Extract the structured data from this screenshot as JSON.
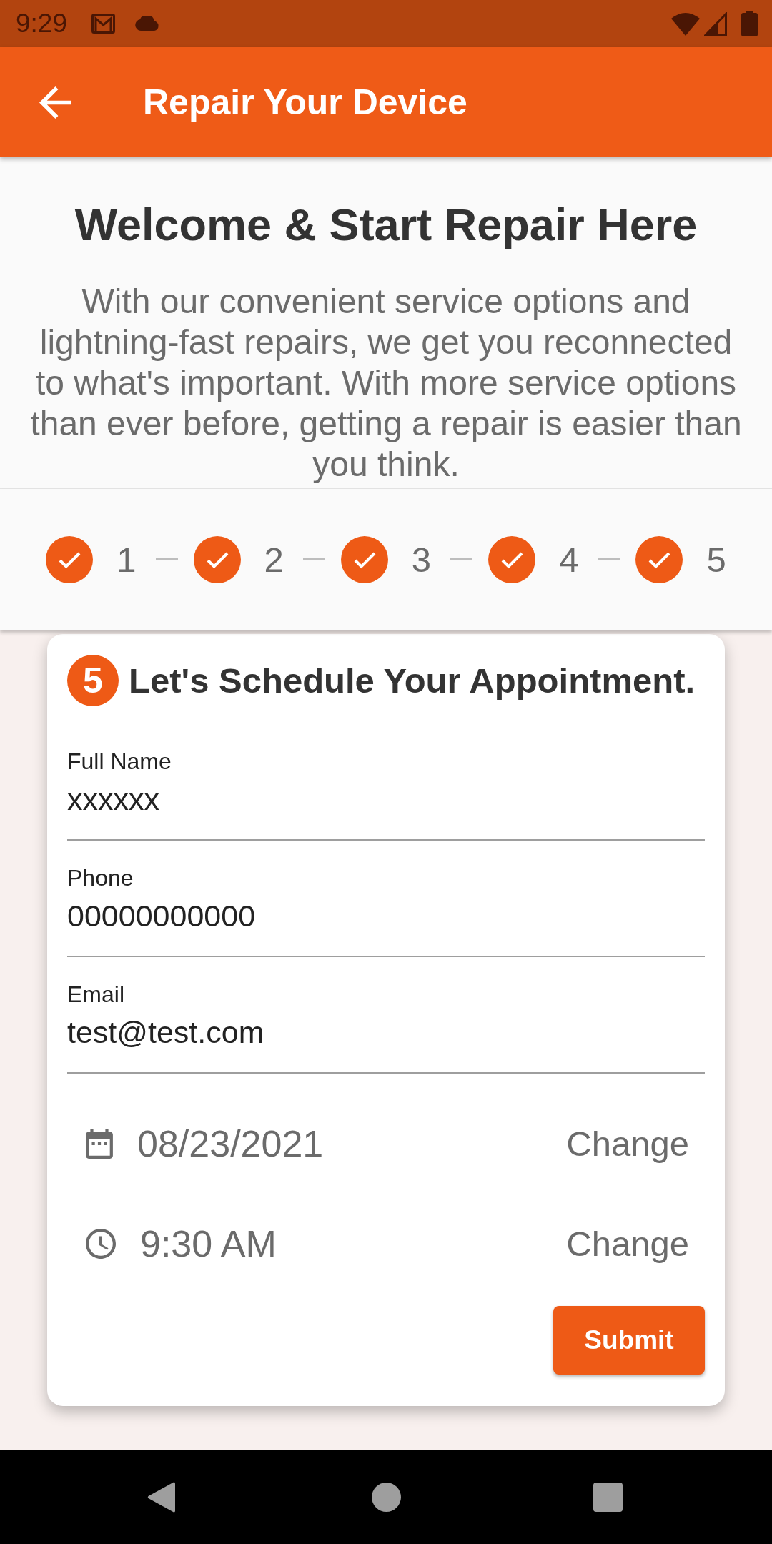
{
  "status_bar": {
    "time": "9:29"
  },
  "app_bar": {
    "title": "Repair Your Device"
  },
  "intro": {
    "title": "Welcome & Start Repair Here",
    "text": "With our convenient service options and lightning-fast repairs, we get you reconnected to what's important. With more service options than ever before, getting a repair is easier than you think."
  },
  "stepper": {
    "steps": [
      {
        "label": "1",
        "completed": true
      },
      {
        "label": "2",
        "completed": true
      },
      {
        "label": "3",
        "completed": true
      },
      {
        "label": "4",
        "completed": true
      },
      {
        "label": "5",
        "completed": true
      }
    ]
  },
  "appointment_card": {
    "step_badge": "5",
    "title": "Let's Schedule Your Appointment.",
    "fields": [
      {
        "label": "Full Name",
        "value": "xxxxxx"
      },
      {
        "label": "Phone",
        "value": "00000000000"
      },
      {
        "label": "Email",
        "value": "test@test.com"
      }
    ],
    "schedule": [
      {
        "kind": "date",
        "value": "08/23/2021",
        "action": "Change"
      },
      {
        "kind": "time",
        "value": "9:30 AM",
        "action": "Change"
      }
    ],
    "submit_button": "Submit"
  }
}
